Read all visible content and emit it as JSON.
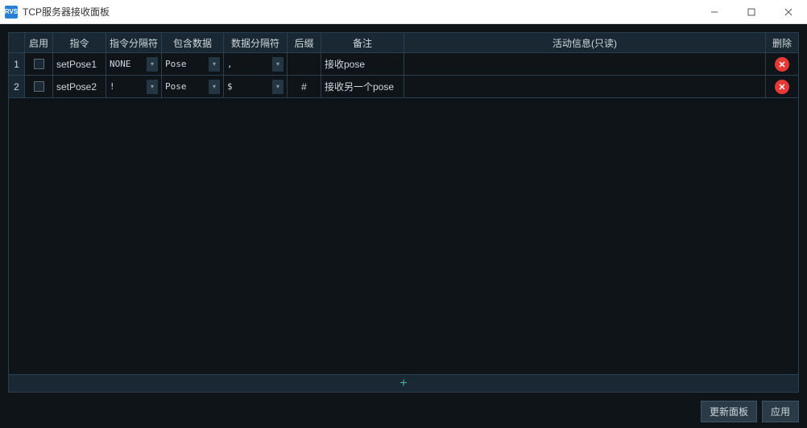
{
  "window": {
    "icon_text": "RVS",
    "title": "TCP服务器接收面板"
  },
  "columns": {
    "enable": "启用",
    "cmd": "指令",
    "sep1": "指令分隔符",
    "data": "包含数据",
    "sep2": "数据分隔符",
    "suffix": "后缀",
    "remark": "备注",
    "info": "活动信息(只读)",
    "delete": "删除"
  },
  "rows": [
    {
      "num": "1",
      "cmd": "setPose1",
      "sep1": "NONE",
      "data": "Pose",
      "sep2": ",",
      "suffix": "",
      "remark": "接收pose",
      "info": ""
    },
    {
      "num": "2",
      "cmd": "setPose2",
      "sep1": "!",
      "data": "Pose",
      "sep2": "$",
      "suffix": "#",
      "remark": "接收另一个pose",
      "info": ""
    }
  ],
  "footer": {
    "update": "更新面板",
    "apply": "应用"
  },
  "add_symbol": "+"
}
